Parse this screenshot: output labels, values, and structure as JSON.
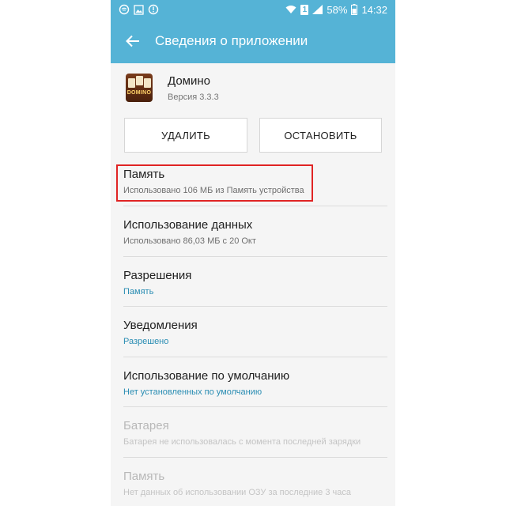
{
  "status_bar": {
    "battery": "58%",
    "time": "14:32",
    "sim_slot": "1",
    "icons_left": [
      "wifi-off-icon",
      "image-icon",
      "alert-icon"
    ],
    "icons_right": [
      "wifi-icon",
      "sim-icon",
      "signal-icon",
      "battery-icon"
    ]
  },
  "toolbar": {
    "title": "Сведения о приложении",
    "back_icon": "arrow-left-icon"
  },
  "app": {
    "name": "Домино",
    "version": "Версия 3.3.3",
    "icon_label": "DOMINO"
  },
  "buttons": {
    "uninstall": "УДАЛИТЬ",
    "force_stop": "ОСТАНОВИТЬ"
  },
  "items": [
    {
      "title": "Память",
      "subtitle": "Использовано 106 МБ из Память устройства"
    },
    {
      "title": "Использование данных",
      "subtitle": "Использовано 86,03 МБ с 20 Окт"
    },
    {
      "title": "Разрешения",
      "subtitle": "Память"
    },
    {
      "title": "Уведомления",
      "subtitle": "Разрешено"
    },
    {
      "title": "Использование по умолчанию",
      "subtitle": "Нет установленных по умолчанию"
    },
    {
      "title": "Батарея",
      "subtitle": "Батарея не использовалась с момента последней зарядки"
    },
    {
      "title": "Память",
      "subtitle": "Нет данных об использовании ОЗУ за последние 3 часа"
    }
  ],
  "colors": {
    "header": "#55b3d6",
    "accent_text": "#2a8db3",
    "highlight_border": "#e02424"
  }
}
